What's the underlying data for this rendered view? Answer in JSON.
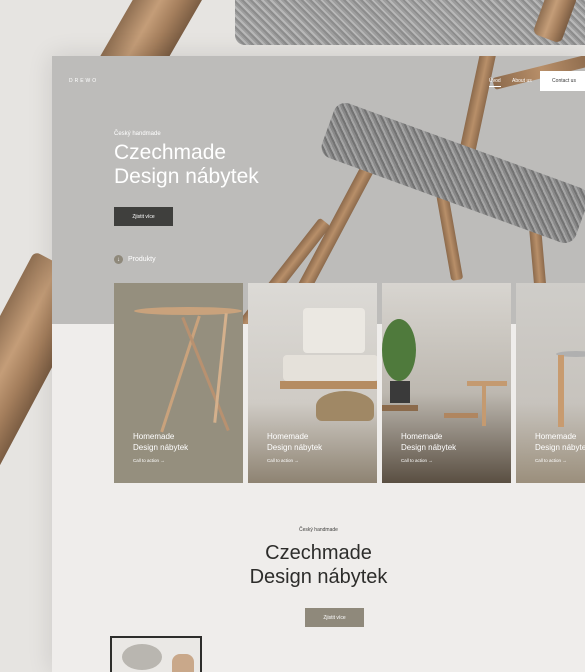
{
  "header": {
    "logo": "DREWO",
    "nav": [
      "Úvod",
      "About us"
    ],
    "contact": "Contact us"
  },
  "hero": {
    "eyebrow": "Český handmade",
    "title_line1": "Czechmade",
    "title_line2": "Design nábytek",
    "button": "Zjistit více",
    "produkty": "Produkty"
  },
  "cards": [
    {
      "title_line1": "Homemade",
      "title_line2": "Design nábytek",
      "cta": "Call to action  →"
    },
    {
      "title_line1": "Homemade",
      "title_line2": "Design nábytek",
      "cta": "Call to action  →"
    },
    {
      "title_line1": "Homemade",
      "title_line2": "Design nábytek",
      "cta": "Call to action  →"
    },
    {
      "title_line1": "Homemade",
      "title_line2": "Design nábytek",
      "cta": "Call to action  →"
    }
  ],
  "section": {
    "eyebrow": "Český handmade",
    "title_line1": "Czechmade",
    "title_line2": "Design nábytek",
    "button": "Zjistit více"
  },
  "colors": {
    "hero_bg": "#bdbcba",
    "page_bg": "#efedeb",
    "accent_taupe": "#8f897b",
    "dark_button": "#3f3f3d"
  }
}
